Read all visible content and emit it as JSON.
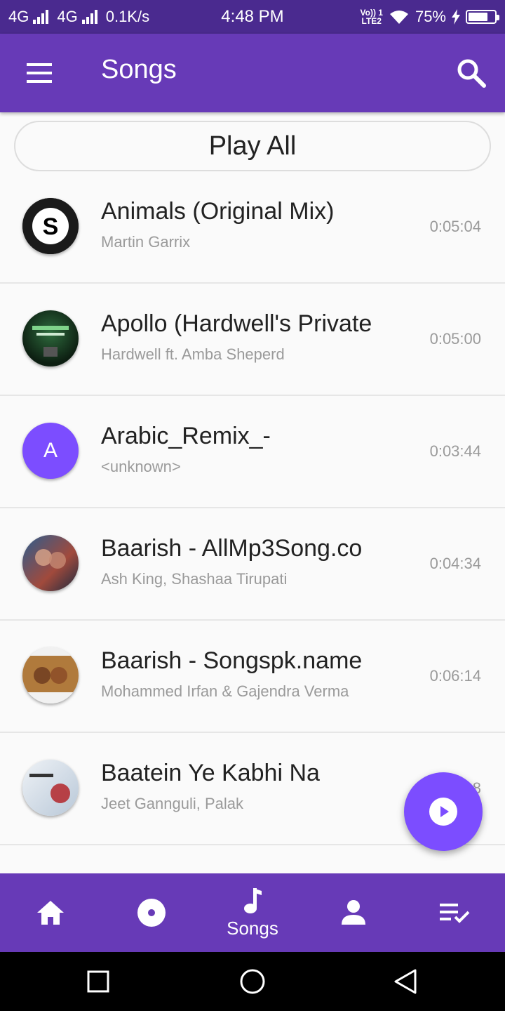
{
  "status_bar": {
    "network1": "4G",
    "network2": "4G",
    "speed": "0.1K/s",
    "time": "4:48 PM",
    "volte_top": "Vo)) 1",
    "volte_bottom": "LTE2",
    "battery": "75%",
    "battery_level": 0.75
  },
  "app_bar": {
    "title": "Songs"
  },
  "play_all_label": "Play All",
  "songs": [
    {
      "title": "Animals (Original Mix)",
      "artist": "Martin Garrix",
      "duration": "0:05:04"
    },
    {
      "title": "Apollo (Hardwell's Private",
      "artist": "Hardwell ft. Amba Sheperd",
      "duration": "0:05:00"
    },
    {
      "title": "Arabic_Remix_-",
      "artist": "<unknown>",
      "duration": "0:03:44",
      "avatar_letter": "A"
    },
    {
      "title": "Baarish - AllMp3Song.co",
      "artist": "Ash King, Shashaa Tirupati",
      "duration": "0:04:34"
    },
    {
      "title": "Baarish - Songspk.name",
      "artist": "Mohammed Irfan & Gajendra Verma",
      "duration": "0:06:14"
    },
    {
      "title": "Baatein Ye Kabhi Na",
      "artist": "Jeet Gannguli, Palak",
      "duration": "8"
    }
  ],
  "bottom_nav": {
    "songs_label": "Songs"
  },
  "colors": {
    "primary": "#673ab7",
    "accent": "#7c4dff",
    "status": "#4a2a8f"
  }
}
